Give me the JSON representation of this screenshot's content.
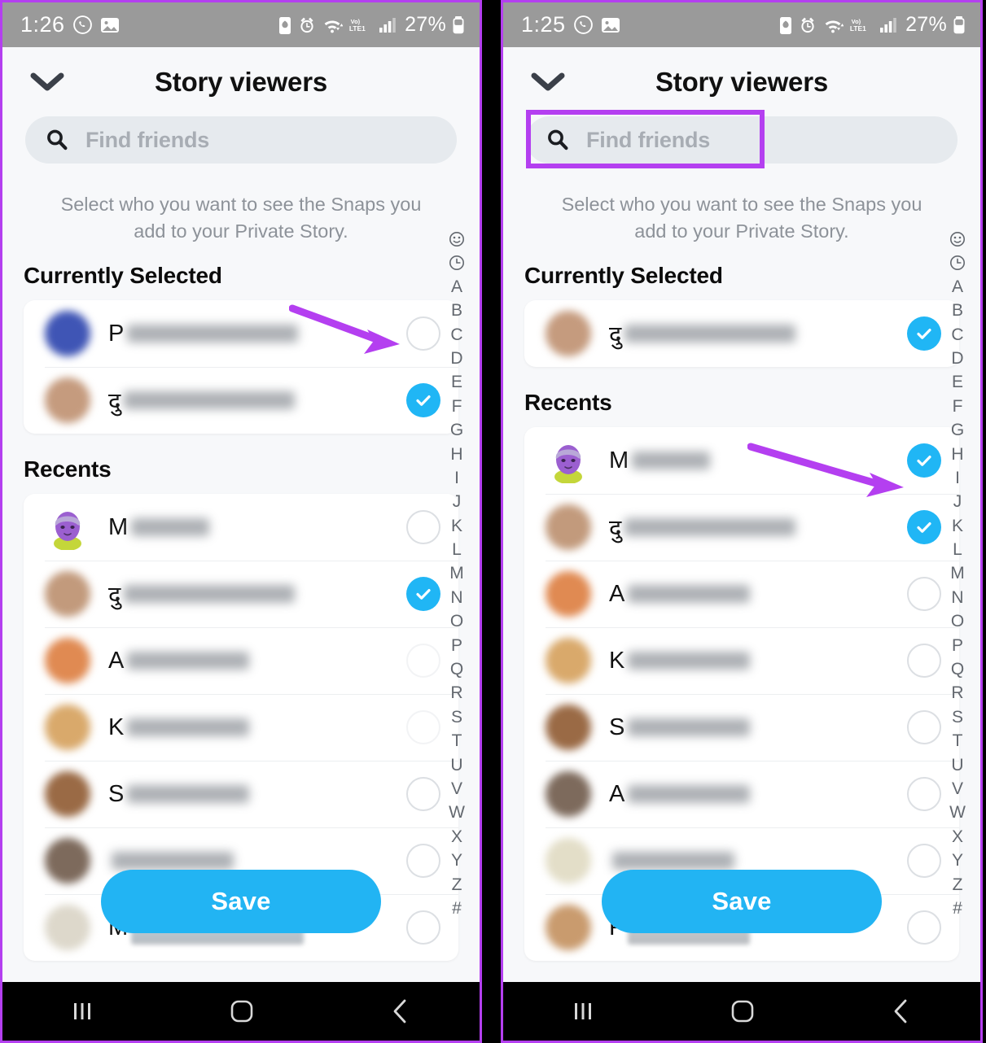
{
  "meta": {
    "app": "Snapchat",
    "accent_blue": "#22b4f3",
    "highlight_purple": "#b43ff0",
    "bg": "#f7f8fa"
  },
  "panels": [
    {
      "id": "left",
      "status_bar": {
        "time": "1:26",
        "battery_percent": "27%",
        "network_label": "LTE1",
        "volte_label": "Vo)",
        "icons": [
          "whatsapp-icon",
          "gallery-icon",
          "battery-saver-icon",
          "alarm-icon",
          "wifi-icon",
          "volte-icon",
          "signal-icon",
          "battery-icon"
        ]
      },
      "header": {
        "title": "Story viewers",
        "back_icon": "chevron-down-icon"
      },
      "search": {
        "placeholder": "Find friends",
        "value": "",
        "icon": "search-icon",
        "highlighted": false
      },
      "subtitle": "Select who you want to see the Snaps you add to your Private Story.",
      "sections": [
        {
          "heading": "Currently Selected",
          "rows": [
            {
              "initial": "P",
              "name_redacted": "wide",
              "avatar": "photo-blue",
              "checked": false
            },
            {
              "initial": "दु",
              "name_redacted": "wide",
              "avatar": "photo-skin",
              "checked": true
            }
          ]
        },
        {
          "heading": "Recents",
          "rows": [
            {
              "initial": "M",
              "name_redacted": "sm",
              "avatar": "bitmoji-purple",
              "checked": false
            },
            {
              "initial": "दु",
              "name_redacted": "wide",
              "avatar": "photo-skin",
              "checked": true
            },
            {
              "initial": "A",
              "name_redacted": "mid",
              "avatar": "photo-orange",
              "checked": false
            },
            {
              "initial": "K",
              "name_redacted": "mid",
              "avatar": "photo-tan",
              "checked": false
            },
            {
              "initial": "S",
              "name_redacted": "mid",
              "avatar": "photo-brown",
              "checked": false
            },
            {
              "initial": "",
              "name_redacted": "mid",
              "avatar": "photo-dark",
              "checked": false
            },
            {
              "initial": "M",
              "name_redacted": "solid",
              "avatar": "photo-light",
              "checked": false
            }
          ]
        }
      ],
      "save_label": "Save",
      "arrow": {
        "points_to": "unchecked-toggle-row-1",
        "color": "#b43ff0"
      }
    },
    {
      "id": "right",
      "status_bar": {
        "time": "1:25",
        "battery_percent": "27%",
        "network_label": "LTE1",
        "volte_label": "Vo)",
        "icons": [
          "whatsapp-icon",
          "gallery-icon",
          "battery-saver-icon",
          "alarm-icon",
          "wifi-icon",
          "volte-icon",
          "signal-icon",
          "battery-icon"
        ]
      },
      "header": {
        "title": "Story viewers",
        "back_icon": "chevron-down-icon"
      },
      "search": {
        "placeholder": "Find friends",
        "value": "",
        "icon": "search-icon",
        "highlighted": true
      },
      "subtitle": "Select who you want to see the Snaps you add to your Private Story.",
      "sections": [
        {
          "heading": "Currently Selected",
          "rows": [
            {
              "initial": "दु",
              "name_redacted": "wide",
              "avatar": "photo-skin",
              "checked": true
            }
          ]
        },
        {
          "heading": "Recents",
          "rows": [
            {
              "initial": "M",
              "name_redacted": "sm",
              "avatar": "bitmoji-purple",
              "checked": true
            },
            {
              "initial": "दु",
              "name_redacted": "wide",
              "avatar": "photo-skin",
              "checked": true
            },
            {
              "initial": "A",
              "name_redacted": "mid",
              "avatar": "photo-orange",
              "checked": false
            },
            {
              "initial": "K",
              "name_redacted": "mid",
              "avatar": "photo-tan",
              "checked": false
            },
            {
              "initial": "S",
              "name_redacted": "mid",
              "avatar": "photo-brown",
              "checked": false
            },
            {
              "initial": "A",
              "name_redacted": "mid",
              "avatar": "photo-dark",
              "checked": false
            },
            {
              "initial": "",
              "name_redacted": "mid",
              "avatar": "photo-light",
              "checked": false
            },
            {
              "initial": "P",
              "name_redacted": "solid",
              "avatar": "photo-warm",
              "checked": false
            }
          ]
        }
      ],
      "save_label": "Save",
      "arrow": {
        "points_to": "checked-toggle-recents-row-1",
        "color": "#b43ff0"
      }
    }
  ],
  "alphabet_index": [
    "smiley-icon",
    "clock-icon",
    "A",
    "B",
    "C",
    "D",
    "E",
    "F",
    "G",
    "H",
    "I",
    "J",
    "K",
    "L",
    "M",
    "N",
    "O",
    "P",
    "Q",
    "R",
    "S",
    "T",
    "U",
    "V",
    "W",
    "X",
    "Y",
    "Z",
    "#"
  ],
  "nav_bar": {
    "recents_icon": "recents-lines-icon",
    "home_icon": "home-square-icon",
    "back_icon": "back-chevron-icon"
  }
}
